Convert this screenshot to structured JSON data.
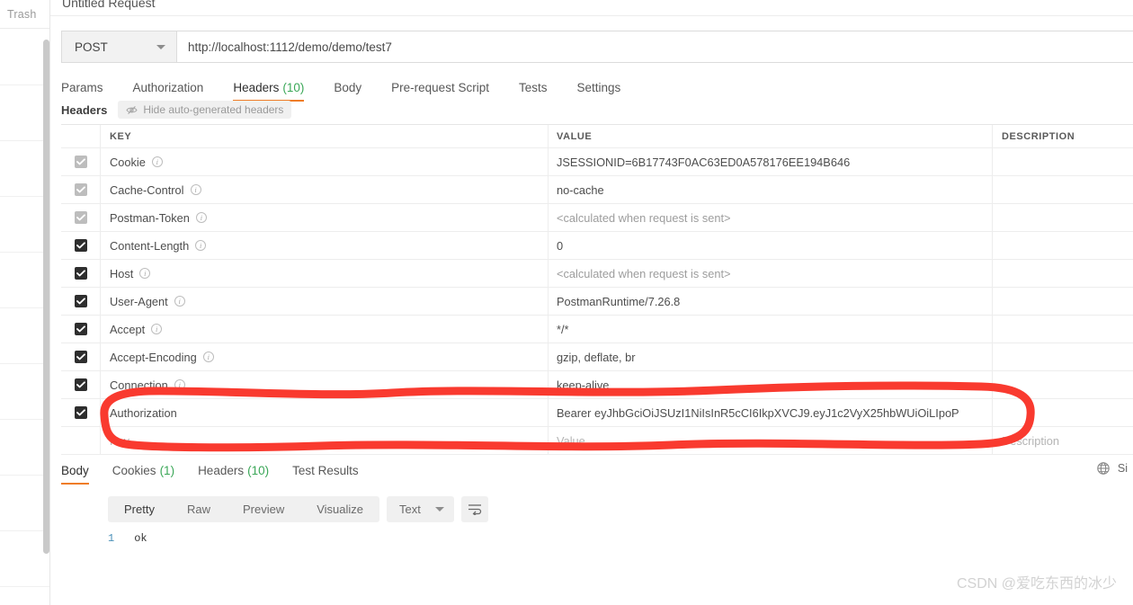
{
  "sidebar": {
    "header_label": "Trash"
  },
  "request": {
    "title": "Untitled Request",
    "method": "POST",
    "url": "http://localhost:1112/demo/demo/test7",
    "tabs": [
      {
        "label": "Params",
        "count": "",
        "active": false
      },
      {
        "label": "Authorization",
        "count": "",
        "active": false
      },
      {
        "label": "Headers",
        "count": "(10)",
        "active": true
      },
      {
        "label": "Body",
        "count": "",
        "active": false
      },
      {
        "label": "Pre-request Script",
        "count": "",
        "active": false
      },
      {
        "label": "Tests",
        "count": "",
        "active": false
      },
      {
        "label": "Settings",
        "count": "",
        "active": false
      }
    ],
    "subbar": {
      "title": "Headers",
      "hide_auto_label": "Hide auto-generated headers"
    }
  },
  "headers_table": {
    "columns": {
      "key": "KEY",
      "value": "VALUE",
      "description": "DESCRIPTION"
    },
    "rows": [
      {
        "checked": true,
        "dim": true,
        "info": true,
        "key": "Cookie",
        "value": "JSESSIONID=6B17743F0AC63ED0A578176EE194B646",
        "value_muted": false,
        "description": ""
      },
      {
        "checked": true,
        "dim": true,
        "info": true,
        "key": "Cache-Control",
        "value": "no-cache",
        "value_muted": false,
        "description": ""
      },
      {
        "checked": true,
        "dim": true,
        "info": true,
        "key": "Postman-Token",
        "value": "<calculated when request is sent>",
        "value_muted": true,
        "description": ""
      },
      {
        "checked": true,
        "dim": false,
        "info": true,
        "key": "Content-Length",
        "value": "0",
        "value_muted": false,
        "description": ""
      },
      {
        "checked": true,
        "dim": false,
        "info": true,
        "key": "Host",
        "value": "<calculated when request is sent>",
        "value_muted": true,
        "description": ""
      },
      {
        "checked": true,
        "dim": false,
        "info": true,
        "key": "User-Agent",
        "value": "PostmanRuntime/7.26.8",
        "value_muted": false,
        "description": ""
      },
      {
        "checked": true,
        "dim": false,
        "info": true,
        "key": "Accept",
        "value": "*/*",
        "value_muted": false,
        "description": ""
      },
      {
        "checked": true,
        "dim": false,
        "info": true,
        "key": "Accept-Encoding",
        "value": "gzip, deflate, br",
        "value_muted": false,
        "description": ""
      },
      {
        "checked": true,
        "dim": false,
        "info": true,
        "key": "Connection",
        "value": "keep-alive",
        "value_muted": false,
        "description": ""
      },
      {
        "checked": true,
        "dim": false,
        "info": false,
        "key": "Authorization",
        "value": "Bearer eyJhbGciOiJSUzI1NiIsInR5cCI6IkpXVCJ9.eyJ1c2VyX25hbWUiOiLIpoP",
        "value_muted": false,
        "description": ""
      }
    ],
    "new_row": {
      "key_placeholder": "Key",
      "value_placeholder": "Value",
      "description_placeholder": "Description"
    }
  },
  "response": {
    "tabs": [
      {
        "label": "Body",
        "count": "",
        "active": true
      },
      {
        "label": "Cookies",
        "count": "(1)",
        "active": false
      },
      {
        "label": "Headers",
        "count": "(10)",
        "active": false
      },
      {
        "label": "Test Results",
        "count": "",
        "active": false
      }
    ],
    "size_label": "Si",
    "view_modes": [
      {
        "label": "Pretty",
        "active": true
      },
      {
        "label": "Raw",
        "active": false
      },
      {
        "label": "Preview",
        "active": false
      },
      {
        "label": "Visualize",
        "active": false
      }
    ],
    "format": "Text",
    "body_lines": [
      {
        "number": "1",
        "text": "ok"
      }
    ]
  },
  "annotation": {
    "color": "#f93a2f"
  },
  "watermark": "CSDN @爱吃东西的冰少",
  "colors": {
    "accent": "#ef7d28",
    "count_green": "#3aa757",
    "annotation_red": "#f93a2f"
  }
}
